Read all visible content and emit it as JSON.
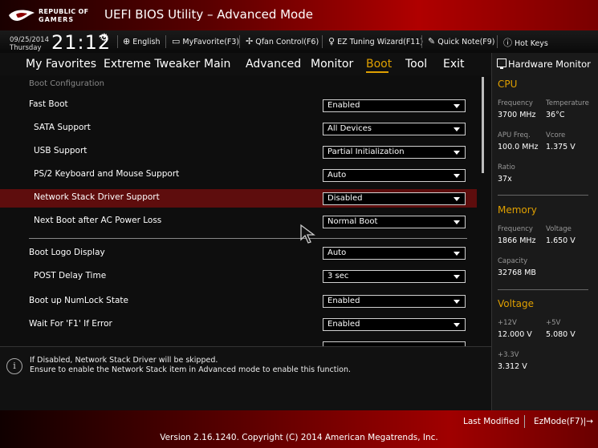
{
  "header": {
    "brand_line1": "REPUBLIC OF",
    "brand_line2": "GAMERS",
    "title": "UEFI BIOS Utility – Advanced Mode"
  },
  "status": {
    "date": "09/25/2014",
    "day": "Thursday",
    "time": "21:12"
  },
  "toolbar": {
    "language": "English",
    "myfavorite": "MyFavorite(F3)",
    "qfan": "Qfan Control(F6)",
    "ez_tuning": "EZ Tuning Wizard(F11)",
    "quick_note": "Quick Note(F9)",
    "hot_keys": "Hot Keys"
  },
  "menu": {
    "items": [
      "My Favorites",
      "Extreme Tweaker",
      "Main",
      "Advanced",
      "Monitor",
      "Boot",
      "Tool",
      "Exit"
    ],
    "active": "Boot"
  },
  "main": {
    "section": "Boot Configuration",
    "options": [
      {
        "label": "Fast Boot",
        "value": "Enabled"
      },
      {
        "label": "SATA Support",
        "value": "All Devices"
      },
      {
        "label": "USB Support",
        "value": "Partial Initialization"
      },
      {
        "label": "PS/2 Keyboard and Mouse Support",
        "value": "Auto"
      },
      {
        "label": "Network Stack Driver Support",
        "value": "Disabled"
      },
      {
        "label": "Next Boot after AC Power Loss",
        "value": "Normal Boot"
      },
      {
        "label": "Boot Logo Display",
        "value": "Auto"
      },
      {
        "label": "POST Delay Time",
        "value": "3 sec"
      },
      {
        "label": "Boot up NumLock State",
        "value": "Enabled"
      },
      {
        "label": "Wait For 'F1' If Error",
        "value": "Enabled"
      }
    ]
  },
  "help": {
    "line1": "If Disabled, Network Stack Driver will be skipped.",
    "line2": "Ensure to enable the Network Stack item in Advanced mode to enable this function."
  },
  "hw_monitor": {
    "title": "Hardware Monitor",
    "cpu": {
      "section": "CPU",
      "frequency_label": "Frequency",
      "frequency": "3700 MHz",
      "temperature_label": "Temperature",
      "temperature": "36°C",
      "apu_label": "APU Freq.",
      "apu": "100.0 MHz",
      "vcore_label": "Vcore",
      "vcore": "1.375 V",
      "ratio_label": "Ratio",
      "ratio": "37x"
    },
    "memory": {
      "section": "Memory",
      "frequency_label": "Frequency",
      "frequency": "1866 MHz",
      "voltage_label": "Voltage",
      "voltage": "1.650 V",
      "capacity_label": "Capacity",
      "capacity": "32768 MB"
    },
    "voltage": {
      "section": "Voltage",
      "v12_label": "+12V",
      "v12": "12.000 V",
      "v5_label": "+5V",
      "v5": "5.080 V",
      "v33_label": "+3.3V",
      "v33": "3.312 V"
    }
  },
  "footer": {
    "last_modified": "Last Modified",
    "ezmode": "EzMode(F7)|→",
    "version": "Version 2.16.1240. Copyright (C) 2014 American Megatrends, Inc."
  },
  "colors": {
    "accent": "#e0a000",
    "highlight_row": "#5e0d0d",
    "header_red": "#b00000"
  }
}
